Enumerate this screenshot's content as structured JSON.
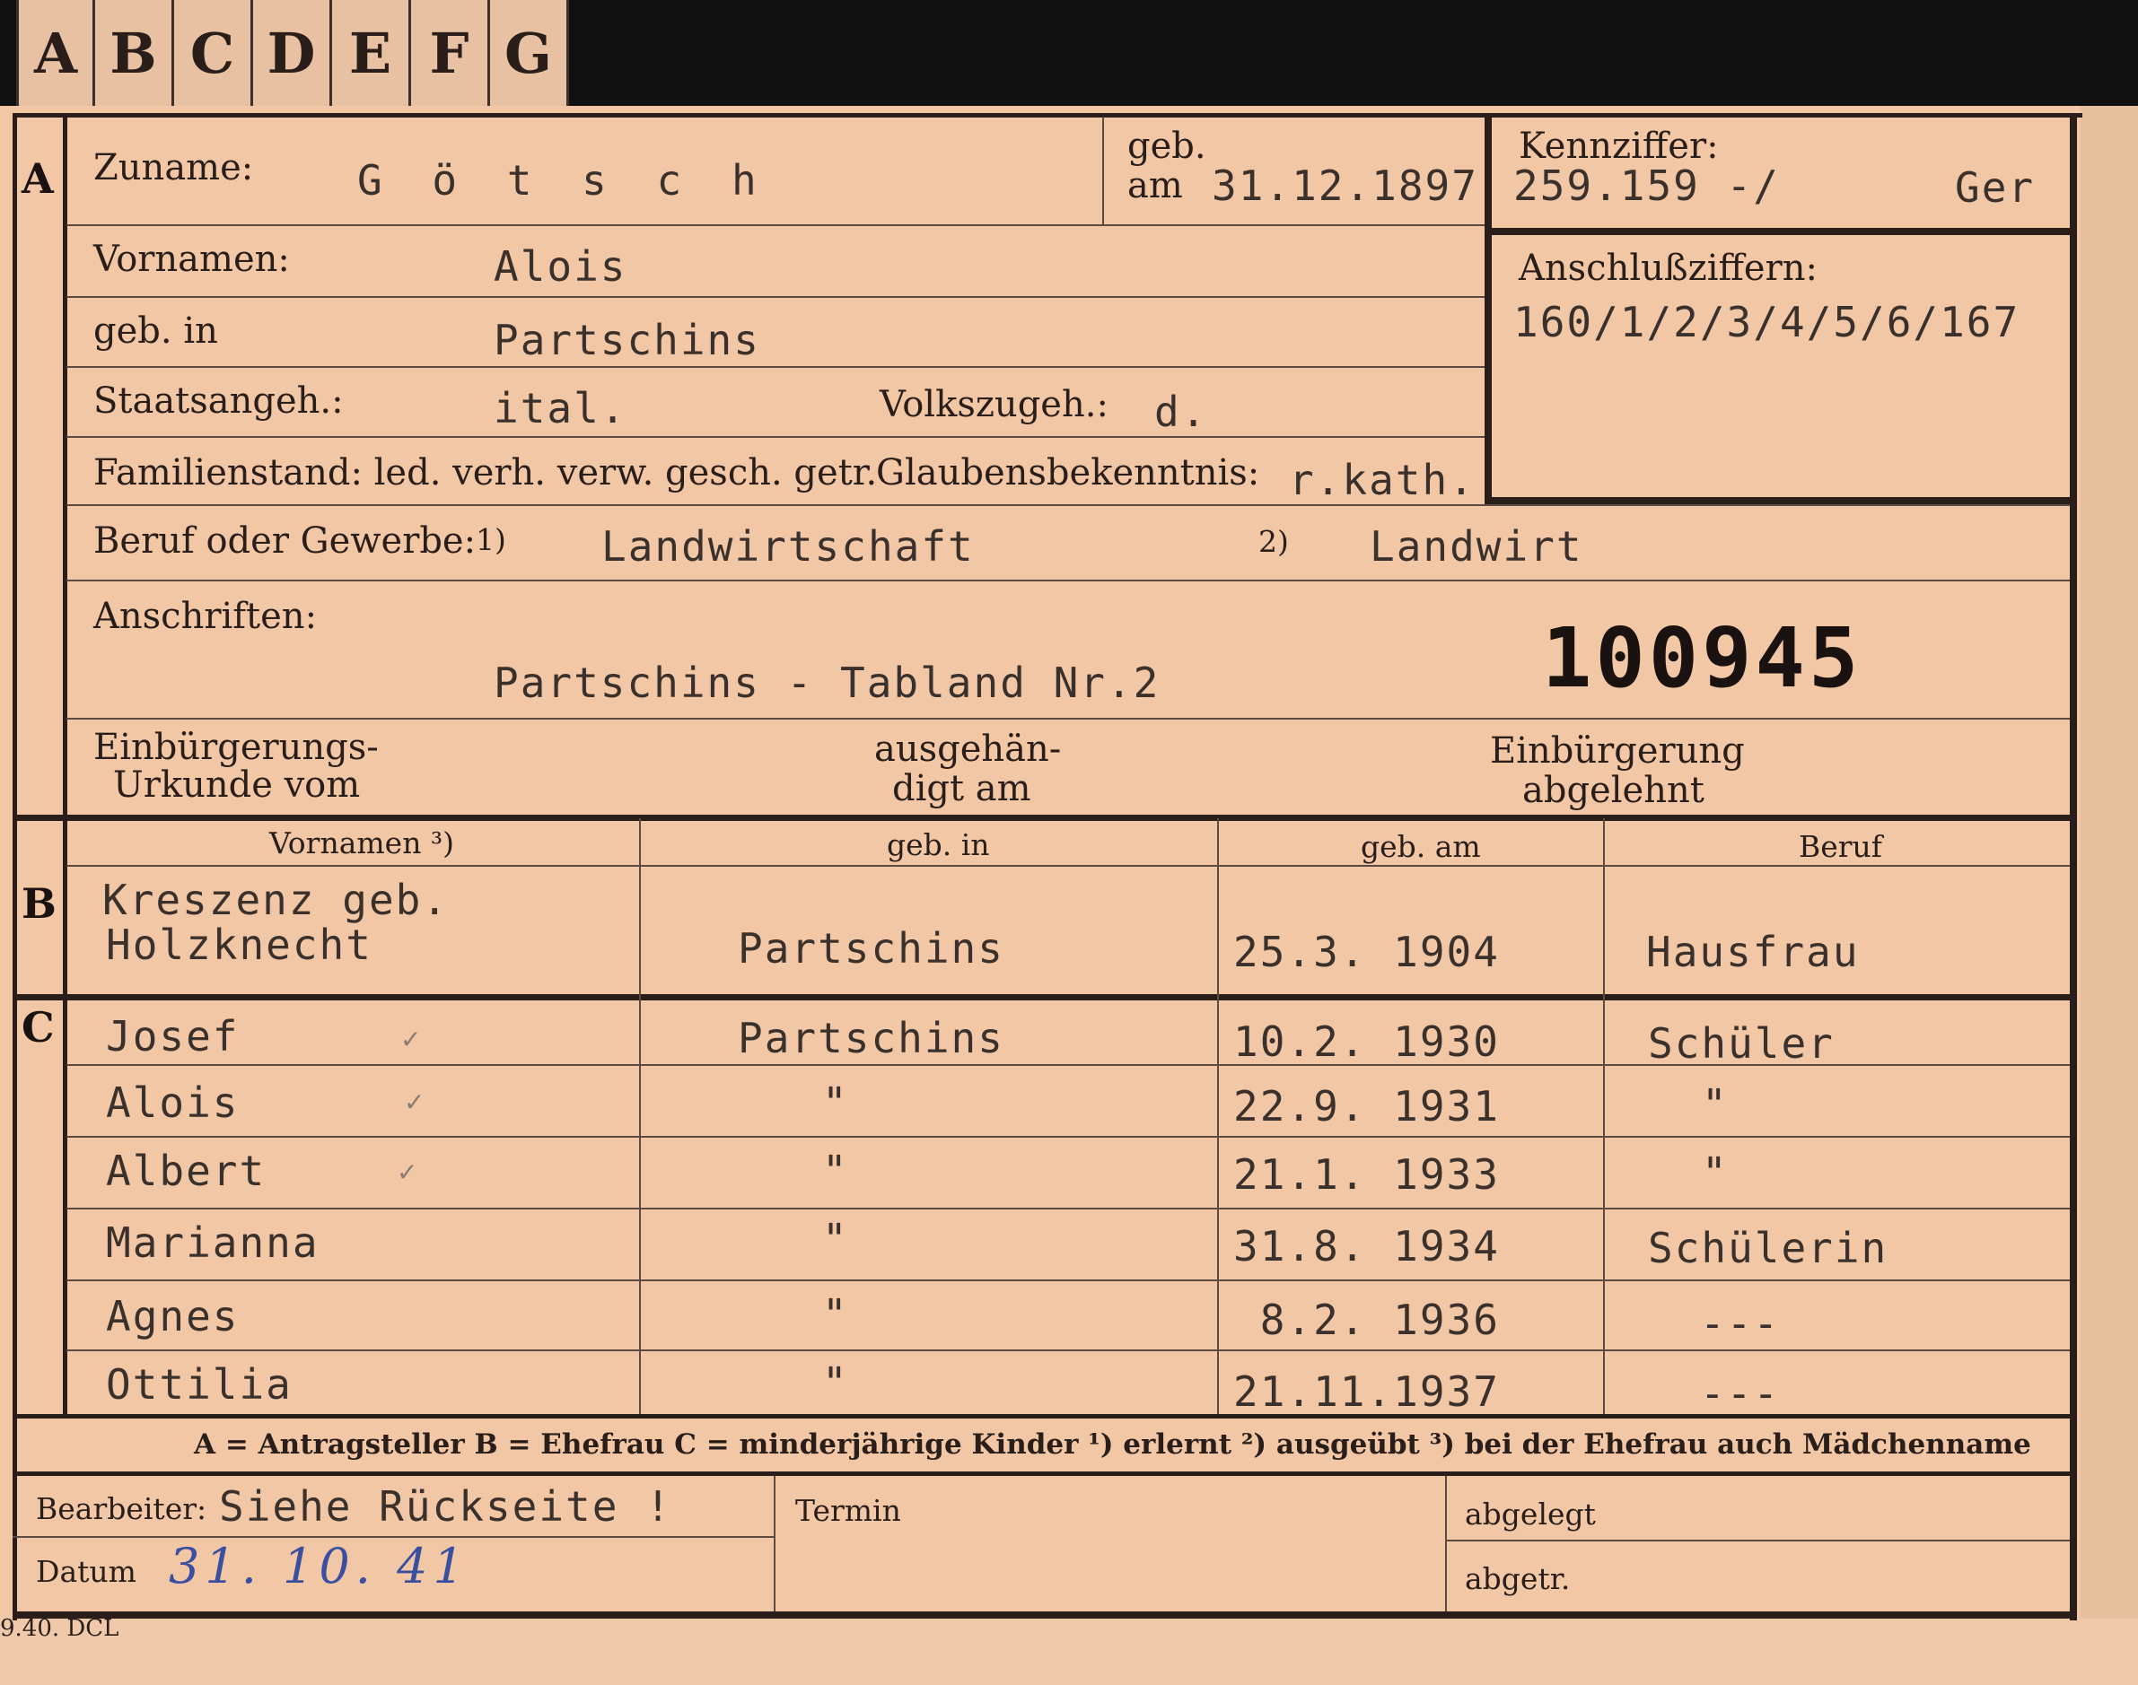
{
  "tabs": [
    "A",
    "B",
    "C",
    "D",
    "E",
    "F",
    "G"
  ],
  "section_letters": {
    "a": "A",
    "b": "B",
    "c": "C"
  },
  "applicant": {
    "zuname_label": "Zuname:",
    "zuname_value": "G ö t s c h",
    "geb_label": "geb.",
    "am_label": "am",
    "geb_am_value": "31.12.1897",
    "kennziffer_label": "Kennziffer:",
    "kennziffer_value": "259.159 -/",
    "kennziffer_suffix": "Ger",
    "anschluss_label": "Anschlußziffern:",
    "anschluss_value": "160/1/2/3/4/5/6/167",
    "vornamen_label": "Vornamen:",
    "vornamen_value": "Alois",
    "geb_in_label": "geb. in",
    "geb_in_value": "Partschins",
    "staat_label": "Staatsangeh.:",
    "staat_value": "ital.",
    "volk_label": "Volkszugeh.:",
    "volk_value": "d.",
    "familienstand_label": "Familienstand: led. verh. verw. gesch. getr.",
    "glaube_label": "Glaubensbekenntnis:",
    "glaube_value": "r.kath.",
    "beruf_label": "Beruf oder Gewerbe:",
    "beruf_note1": "1)",
    "beruf_value1": "Landwirtschaft",
    "beruf_note2": "2)",
    "beruf_value2": "Landwirt",
    "anschriften_label": "Anschriften:",
    "anschriften_value": "Partschins - Tabland  Nr.2",
    "stamp_number": "100945",
    "einb_urkunde_label_1": "Einbürgerungs-",
    "einb_urkunde_label_2": "Urkunde vom",
    "ausgehaend_label_1": "ausgehän-",
    "ausgehaend_label_2": "digt am",
    "einb_abgelehnt_label_1": "Einbürgerung",
    "einb_abgelehnt_label_2": "abgelehnt"
  },
  "table_headers": [
    "Vornamen ³)",
    "geb. in",
    "geb. am",
    "Beruf"
  ],
  "spouse": {
    "name_line1": "Kreszenz geb.",
    "name_line2": "Holzknecht",
    "geb_in": "Partschins",
    "geb_am": "25.3. 1904",
    "beruf": "Hausfrau"
  },
  "children": [
    {
      "name": "Josef",
      "check": "✓",
      "geb_in": "Partschins",
      "geb_am": "10.2. 1930",
      "beruf": "Schüler"
    },
    {
      "name": "Alois",
      "check": "✓",
      "geb_in": "\"",
      "geb_am": "22.9. 1931",
      "beruf": "\""
    },
    {
      "name": "Albert",
      "check": "✓",
      "geb_in": "\"",
      "geb_am": "21.1. 1933",
      "beruf": "\""
    },
    {
      "name": "Marianna",
      "check": "",
      "geb_in": "\"",
      "geb_am": "31.8. 1934",
      "beruf": "Schülerin"
    },
    {
      "name": "Agnes",
      "check": "",
      "geb_in": "\"",
      "geb_am": " 8.2. 1936",
      "beruf": "---"
    },
    {
      "name": "Ottilia",
      "check": "",
      "geb_in": "\"",
      "geb_am": "21.11.1937",
      "beruf": "---"
    }
  ],
  "legend": "A = Antragsteller   B = Ehefrau   C = minderjährige Kinder   ¹) erlernt   ²) ausgeübt   ³) bei der Ehefrau auch Mädchenname",
  "footer": {
    "bearbeiter_label": "Bearbeiter:",
    "bearbeiter_value": "Siehe Rückseite !",
    "datum_label": "Datum",
    "datum_value": "31. 10. 41",
    "termin_label": "Termin",
    "abgelegt_label": "abgelegt",
    "abgetr_label": "abgetr.",
    "print_code": "9.40. DCL"
  }
}
